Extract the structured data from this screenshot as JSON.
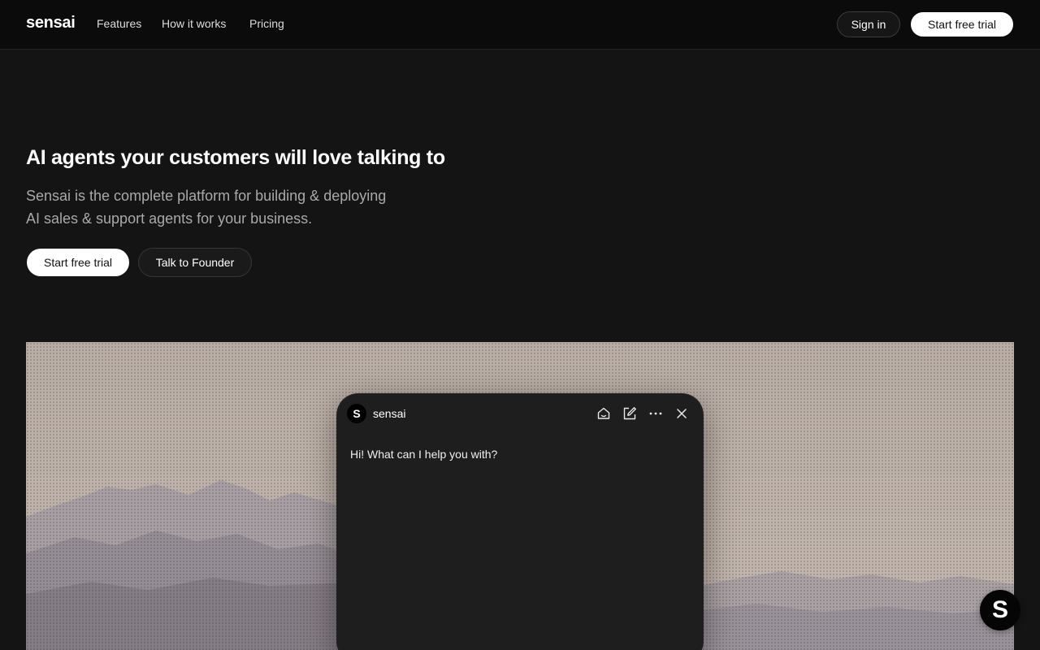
{
  "nav": {
    "logo": "sensai",
    "links": [
      "Features",
      "How it works",
      "Pricing"
    ],
    "sign_in": "Sign in",
    "start_trial": "Start free trial"
  },
  "hero": {
    "title": "AI agents your customers will love talking to",
    "subtitle_line1": "Sensai is the complete platform for building & deploying",
    "subtitle_line2": "AI sales & support agents for your business.",
    "cta_primary": "Start free trial",
    "cta_secondary": "Talk to Founder"
  },
  "chat_widget": {
    "avatar_letter": "S",
    "name": "sensai",
    "greeting": "Hi! What can I help you with?",
    "icons": [
      "home-icon",
      "edit-icon",
      "more-icon",
      "close-icon"
    ]
  },
  "fab": {
    "letter": "S"
  },
  "colors": {
    "background": "#141414",
    "nav_background": "#0b0b0b",
    "primary_button": "#ffffff",
    "chat_background": "#1e1e1e",
    "scene_background": "#b7aea6"
  }
}
